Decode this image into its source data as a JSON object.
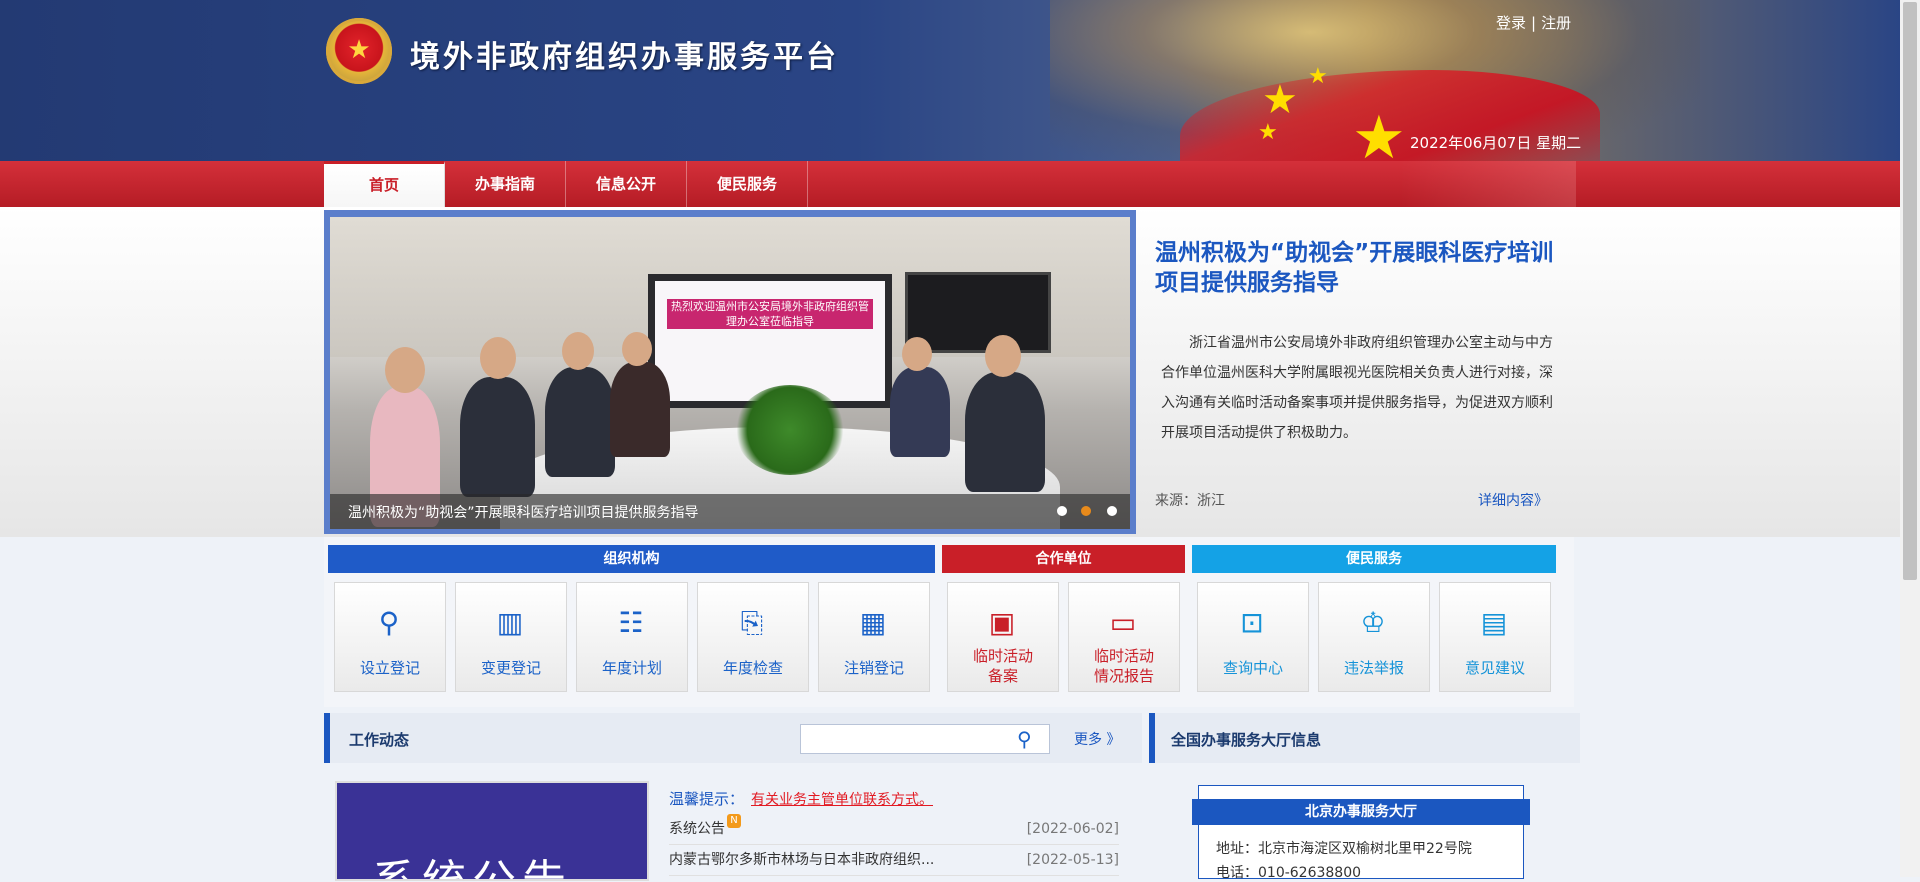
{
  "header": {
    "site_title": "境外非政府组织办事服务平台",
    "login": "登录",
    "separator": "|",
    "register": "注册",
    "date": "2022年06月07日 星期二"
  },
  "nav": [
    {
      "label": "首页",
      "active": true
    },
    {
      "label": "办事指南",
      "active": false
    },
    {
      "label": "信息公开",
      "active": false
    },
    {
      "label": "便民服务",
      "active": false
    }
  ],
  "slider": {
    "caption": "温州积极为“助视会”开展眼科医疗培训项目提供服务指导",
    "screen_text": "热烈欢迎温州市公安局境外非政府组织管理办公室莅临指导",
    "dot_count": 3,
    "active_dot": 2
  },
  "featured": {
    "title": "温州积极为“助视会”开展眼科医疗培训项目提供服务指导",
    "body": "浙江省温州市公安局境外非政府组织管理办公室主动与中方合作单位温州医科大学附属眼视光医院相关负责人进行对接，深入沟通有关临时活动备案事项并提供服务指导，为促进双方顺利开展项目活动提供了积极助力。",
    "source": "来源：浙江",
    "more": "详细内容》"
  },
  "categories": {
    "org": "组织机构",
    "partner": "合作单位",
    "public": "便民服务"
  },
  "tiles": [
    {
      "label": "设立登记",
      "icon": "stamp-icon",
      "glyph": "⚲"
    },
    {
      "label": "变更登记",
      "icon": "building-edit-icon",
      "glyph": "▥"
    },
    {
      "label": "年度计划",
      "icon": "clipboard-icon",
      "glyph": "☷"
    },
    {
      "label": "年度检查",
      "icon": "inspection-icon",
      "glyph": "⎘"
    },
    {
      "label": "注销登记",
      "icon": "building-cancel-icon",
      "glyph": "▦"
    },
    {
      "label": "临时活动",
      "label2": "备案",
      "icon": "archive-icon",
      "glyph": "▣"
    },
    {
      "label": "临时活动",
      "label2": "情况报告",
      "icon": "report-chat-icon",
      "glyph": "▭"
    },
    {
      "label": "查询中心",
      "icon": "monitor-search-icon",
      "glyph": "⊡"
    },
    {
      "label": "违法举报",
      "icon": "police-icon",
      "glyph": "♔"
    },
    {
      "label": "意见建议",
      "icon": "calendar-note-icon",
      "glyph": "▤"
    }
  ],
  "news": {
    "title": "工作动态",
    "search_placeholder": "",
    "more": "更多 》",
    "image_text": "系统公告",
    "notice_label": "温馨提示：",
    "notice_link": "有关业务主管单位联系方式。",
    "items": [
      {
        "title": "系统公告",
        "badge": "N",
        "date": "[2022-06-02]"
      },
      {
        "title": "内蒙古鄂尔多斯市林场与日本非政府组织...",
        "date": "[2022-05-13]"
      }
    ]
  },
  "hall": {
    "title": "全国办事服务大厅信息",
    "name": "北京办事服务大厅",
    "address": "地址：北京市海淀区双榆树北里甲22号院",
    "phone": "电话：010-62638800"
  },
  "colors": {
    "header_blue": "#233a73",
    "nav_red": "#c91f28",
    "link_blue": "#1b57c0",
    "cat_org": "#1f5bc8",
    "cat_partner": "#c91f28",
    "cat_public": "#14a2e6"
  }
}
